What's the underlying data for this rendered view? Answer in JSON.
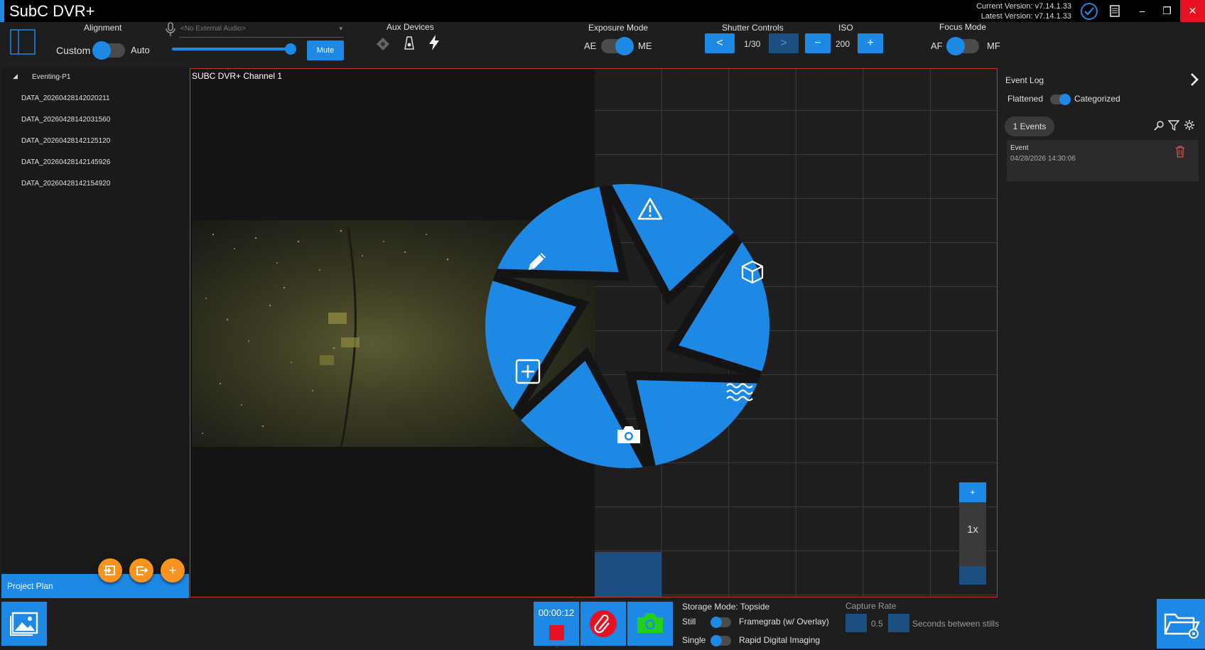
{
  "app": {
    "title": "SubC DVR+",
    "current_version": "Current Version: v7.14.1.33",
    "latest_version": "Latest Version: v7.14.1.33"
  },
  "toolbar": {
    "alignment": {
      "label": "Alignment",
      "left": "Custom",
      "right": "Auto"
    },
    "audio": {
      "placeholder": "<No External Audio>",
      "mute_label": "Mute",
      "level": 0.97
    },
    "aux": {
      "label": "Aux Devices"
    },
    "exposure": {
      "label": "Exposure Mode",
      "left": "AE",
      "right": "ME"
    },
    "shutter": {
      "label": "Shutter Controls",
      "prev": "<",
      "value": "1/30",
      "next": ">"
    },
    "iso": {
      "label": "ISO",
      "minus": "−",
      "value": "200",
      "plus": "+"
    },
    "focus": {
      "label": "Focus Mode",
      "left": "AF",
      "right": "MF"
    }
  },
  "tree": {
    "root": "Eventing-P1",
    "items": [
      "DATA_20260428142020211",
      "DATA_20260428142031560",
      "DATA_20260428142125120",
      "DATA_20260428142145926",
      "DATA_20260428142154920"
    ],
    "project_plan": "Project Plan"
  },
  "video": {
    "caption": "SUBC DVR+ Channel 1",
    "zoom_plus": "+",
    "zoom_level": "1x"
  },
  "event_log": {
    "title": "Event Log",
    "left": "Flattened",
    "right": "Categorized",
    "count_label": "1  Events",
    "events": [
      {
        "name": "Event",
        "timestamp": "04/28/2026 14:30:06"
      }
    ]
  },
  "bottom": {
    "timer": "00:00:12",
    "storage_mode": "Storage Mode: Topside",
    "still": "Still",
    "single": "Single",
    "framegrab": "Framegrab (w/ Overlay)",
    "rapid": "Rapid Digital Imaging",
    "capture_rate_label": "Capture Rate",
    "capture_rate_value": "0.5",
    "seconds_label": "Seconds between stills"
  },
  "colors": {
    "accent": "#1e88e5",
    "orange": "#f7931e",
    "record_red": "#e81123",
    "snapshot_green": "#22d01a"
  },
  "shutter_menu": {
    "segments": [
      "warning-icon",
      "cube-icon",
      "waves-icon",
      "camera-icon",
      "add-square-icon",
      "pencil-icon"
    ]
  }
}
